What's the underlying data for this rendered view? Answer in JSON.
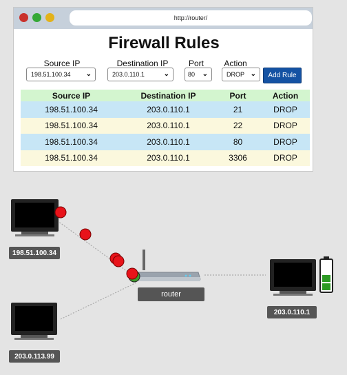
{
  "browser": {
    "url": "http://router/"
  },
  "page": {
    "title": "Firewall Rules"
  },
  "form": {
    "source_ip_label": "Source IP",
    "source_ip_value": "198.51.100.34",
    "destination_ip_label": "Destination IP",
    "destination_ip_value": "203.0.110.1",
    "port_label": "Port",
    "port_value": "80",
    "action_label": "Action",
    "action_value": "DROP",
    "add_rule_button": "Add Rule"
  },
  "table": {
    "columns": [
      "Source IP",
      "Destination IP",
      "Port",
      "Action"
    ],
    "rows": [
      [
        "198.51.100.34",
        "203.0.110.1",
        "21",
        "DROP"
      ],
      [
        "198.51.100.34",
        "203.0.110.1",
        "22",
        "DROP"
      ],
      [
        "198.51.100.34",
        "203.0.110.1",
        "80",
        "DROP"
      ],
      [
        "198.51.100.34",
        "203.0.110.1",
        "3306",
        "DROP"
      ]
    ]
  },
  "network": {
    "hosts": [
      {
        "label": "198.51.100.34"
      },
      {
        "label": "203.0.113.99"
      },
      {
        "label": "203.0.110.1"
      }
    ],
    "router_label": "router",
    "packet_colors": {
      "blocked": "#e8131a",
      "allowed": "#3f9a2e"
    },
    "battery_color": "#2d9a24"
  }
}
